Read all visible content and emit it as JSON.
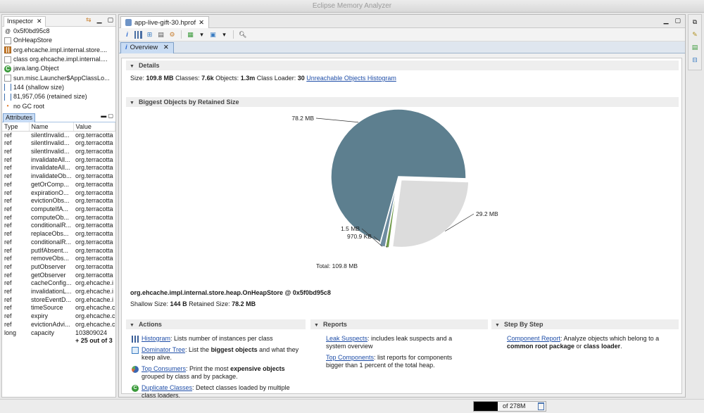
{
  "window": {
    "title": "Eclipse Memory Analyzer"
  },
  "inspector": {
    "tab_label": "Inspector",
    "rows": [
      {
        "icon": "address-icon",
        "text": "0x5f0bd95c8"
      },
      {
        "icon": "document-icon",
        "text": "OnHeapStore"
      },
      {
        "icon": "package-icon",
        "text": "org.ehcache.impl.internal.store...."
      },
      {
        "icon": "document-icon",
        "text": "class org.ehcache.impl.internal...."
      },
      {
        "icon": "class-icon",
        "text": "java.lang.Object"
      },
      {
        "icon": "document-icon",
        "text": "sun.misc.Launcher$AppClassLo..."
      },
      {
        "icon": "size-icon",
        "text": "144 (shallow size)"
      },
      {
        "icon": "size-icon",
        "text": "81,957,056 (retained size)"
      },
      {
        "icon": "gc-root-icon",
        "text": "no GC root"
      }
    ],
    "attributes_tab": "Attributes",
    "columns": [
      "Type",
      "Name",
      "Value"
    ],
    "attributes": [
      [
        "ref",
        "silentInvalid...",
        "org.terracotta"
      ],
      [
        "ref",
        "silentInvalid...",
        "org.terracotta"
      ],
      [
        "ref",
        "silentInvalid...",
        "org.terracotta"
      ],
      [
        "ref",
        "invalidateAll...",
        "org.terracotta"
      ],
      [
        "ref",
        "invalidateAll...",
        "org.terracotta"
      ],
      [
        "ref",
        "invalidateOb...",
        "org.terracotta"
      ],
      [
        "ref",
        "getOrComp...",
        "org.terracotta"
      ],
      [
        "ref",
        "expirationO...",
        "org.terracotta"
      ],
      [
        "ref",
        "evictionObs...",
        "org.terracotta"
      ],
      [
        "ref",
        "computeIfA...",
        "org.terracotta"
      ],
      [
        "ref",
        "computeOb...",
        "org.terracotta"
      ],
      [
        "ref",
        "conditionalR...",
        "org.terracotta"
      ],
      [
        "ref",
        "replaceObs...",
        "org.terracotta"
      ],
      [
        "ref",
        "conditionalR...",
        "org.terracotta"
      ],
      [
        "ref",
        "putIfAbsent...",
        "org.terracotta"
      ],
      [
        "ref",
        "removeObs...",
        "org.terracotta"
      ],
      [
        "ref",
        "putObserver",
        "org.terracotta"
      ],
      [
        "ref",
        "getObserver",
        "org.terracotta"
      ],
      [
        "ref",
        "cacheConfig...",
        "org.ehcache.i"
      ],
      [
        "ref",
        "invalidationL...",
        "org.ehcache.i"
      ],
      [
        "ref",
        "storeEventD...",
        "org.ehcache.i"
      ],
      [
        "ref",
        "timeSource",
        "org.ehcache.c"
      ],
      [
        "ref",
        "expiry",
        "org.ehcache.c"
      ],
      [
        "ref",
        "evictionAdvi...",
        "org.ehcache.c"
      ],
      [
        "long",
        "capacity",
        "103809024"
      ]
    ],
    "more_label": "+ 25 out of 3"
  },
  "editor": {
    "file_tab": "app-live-gift-30.hprof",
    "overview_tab": "Overview",
    "details": {
      "header": "Details",
      "size_label": "Size:",
      "size_value": "109.8 MB",
      "classes_label": "Classes:",
      "classes_value": "7.6k",
      "objects_label": "Objects:",
      "objects_value": "1.3m",
      "classloader_label": "Class Loader:",
      "classloader_value": "30",
      "link": "Unreachable Objects Histogram"
    },
    "biggest": {
      "header": "Biggest Objects by Retained Size",
      "total_label": "Total: 109.8 MB",
      "object_name": "org.ehcache.impl.internal.store.heap.OnHeapStore @ 0x5f0bd95c8",
      "shallow_label": "Shallow Size:",
      "shallow_value": "144 B",
      "retained_label": "Retained Size:",
      "retained_value": "78.2 MB"
    },
    "actions": {
      "header": "Actions",
      "items": [
        {
          "link": "Histogram",
          "text": ": Lists number of instances per class"
        },
        {
          "link": "Dominator Tree",
          "text": ": List the ",
          "bold": "biggest objects",
          "text2": " and what they keep alive."
        },
        {
          "link": "Top Consumers",
          "text": ": Print the most ",
          "bold": "expensive objects",
          "text2": " grouped by class and by package."
        },
        {
          "link": "Duplicate Classes",
          "text": ": Detect classes loaded by multiple class loaders."
        }
      ]
    },
    "reports": {
      "header": "Reports",
      "items": [
        {
          "link": "Leak Suspects",
          "text": ": includes leak suspects and a system overview"
        },
        {
          "link": "Top Components",
          "text": ": list reports for components bigger than 1 percent of the total heap."
        }
      ]
    },
    "stepbystep": {
      "header": "Step By Step",
      "link": "Component Report",
      "text": ": Analyze objects which belong to a ",
      "bold1": "common root package",
      "mid": " or ",
      "bold2": "class loader",
      "end": "."
    }
  },
  "statusbar": {
    "heap_text": "of 278M"
  },
  "chart_data": {
    "type": "pie",
    "slices": [
      {
        "label": "78.2 MB",
        "value": 78.2,
        "color": "#5d7f8f"
      },
      {
        "label": "29.2 MB",
        "value": 29.2,
        "color": "#dcdcdc"
      },
      {
        "label": "970.9 KB",
        "value": 0.95,
        "color": "#6f9a48"
      },
      {
        "label": "1.5 MB",
        "value": 1.5,
        "color": "#6e8ca0"
      }
    ],
    "total_label": "Total: 109.8 MB"
  }
}
